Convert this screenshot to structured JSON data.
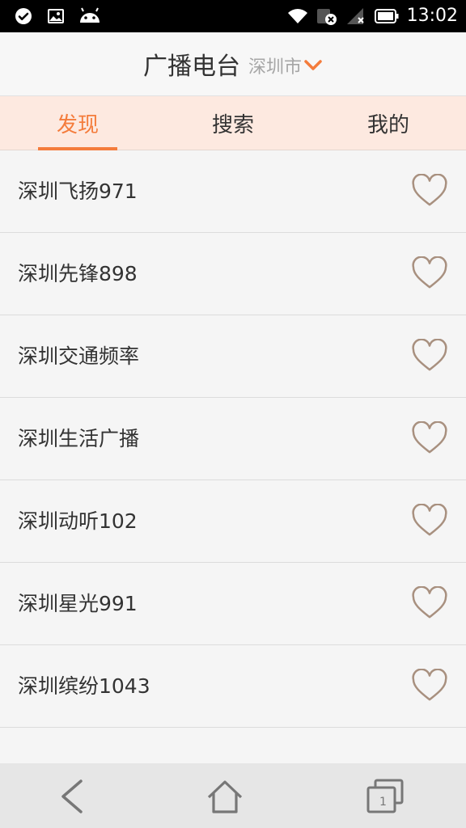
{
  "status_bar": {
    "time": "13:02",
    "icons": [
      "check-circle-icon",
      "image-icon",
      "android-icon",
      "wifi-icon",
      "data-off-icon",
      "signal-icon",
      "battery-icon"
    ]
  },
  "header": {
    "title": "广播电台",
    "city": "深圳市",
    "city_dropdown_icon": "chevron-down-icon"
  },
  "tabs": [
    {
      "label": "发现",
      "active": true
    },
    {
      "label": "搜索",
      "active": false
    },
    {
      "label": "我的",
      "active": false
    }
  ],
  "stations": [
    {
      "name": "深圳飞扬971"
    },
    {
      "name": "深圳先锋898"
    },
    {
      "name": "深圳交通频率"
    },
    {
      "name": "深圳生活广播"
    },
    {
      "name": "深圳动听102"
    },
    {
      "name": "深圳星光991"
    },
    {
      "name": "深圳缤纷1043"
    }
  ],
  "nav_bar": {
    "recents_count": "1"
  },
  "colors": {
    "accent": "#f47c3c",
    "tab_background": "#fde9e0",
    "heart_outline": "#a8907f"
  }
}
